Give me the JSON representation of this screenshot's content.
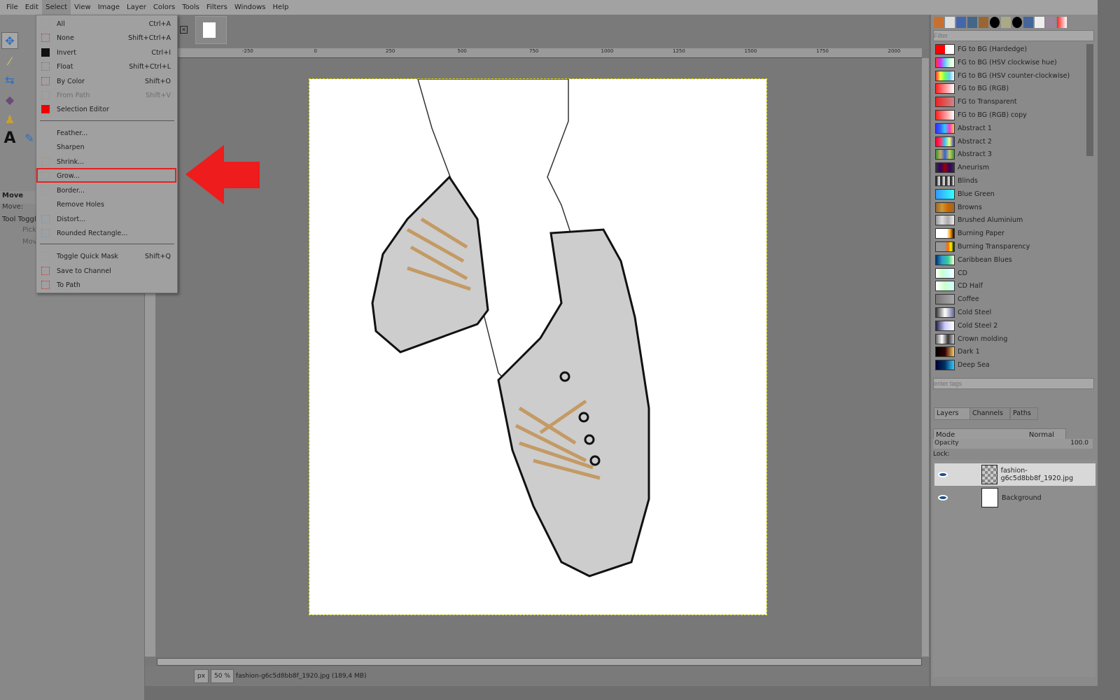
{
  "menubar": {
    "items": [
      "File",
      "Edit",
      "Select",
      "View",
      "Image",
      "Layer",
      "Colors",
      "Tools",
      "Filters",
      "Windows",
      "Help"
    ],
    "active": "Select"
  },
  "select_menu": {
    "items": [
      {
        "label": "All",
        "shortcut": "Ctrl+A",
        "icon": "select-all-icon"
      },
      {
        "label": "None",
        "shortcut": "Shift+Ctrl+A",
        "icon": "select-none-icon"
      },
      {
        "label": "Invert",
        "shortcut": "Ctrl+I",
        "icon": "invert-icon"
      },
      {
        "label": "Float",
        "shortcut": "Shift+Ctrl+L",
        "icon": "float-icon"
      },
      {
        "label": "By Color",
        "shortcut": "Shift+O",
        "icon": "by-color-icon"
      },
      {
        "label": "From Path",
        "shortcut": "Shift+V",
        "icon": "from-path-icon",
        "disabled": true
      },
      {
        "label": "Selection Editor",
        "shortcut": "",
        "icon": "selection-editor-icon"
      },
      {
        "label": "Feather...",
        "shortcut": ""
      },
      {
        "label": "Sharpen",
        "shortcut": ""
      },
      {
        "label": "Shrink...",
        "shortcut": "",
        "icon": "shrink-icon"
      },
      {
        "label": "Grow...",
        "shortcut": "",
        "icon": "grow-icon",
        "highlighted": true
      },
      {
        "label": "Border...",
        "shortcut": "",
        "icon": "border-icon"
      },
      {
        "label": "Remove Holes",
        "shortcut": ""
      },
      {
        "label": "Distort...",
        "shortcut": "",
        "icon": "distort-icon"
      },
      {
        "label": "Rounded Rectangle...",
        "shortcut": "",
        "icon": "rounded-rectangle-icon"
      },
      {
        "label": "Toggle Quick Mask",
        "shortcut": "Shift+Q",
        "icon": "quick-mask-icon"
      },
      {
        "label": "Save to Channel",
        "shortcut": "",
        "icon": "save-channel-icon"
      },
      {
        "label": "To Path",
        "shortcut": "",
        "icon": "to-path-icon"
      }
    ]
  },
  "tool_options": {
    "title": "Move",
    "move_label": "Move:",
    "toggle_label": "Tool Toggle",
    "opt1": "Pick",
    "opt2": "Mov"
  },
  "ruler": {
    "labels": [
      "-250",
      "0",
      "250",
      "500",
      "750",
      "1000",
      "1250",
      "1500",
      "1750",
      "2000"
    ]
  },
  "status": {
    "unit": "px",
    "zoom": "50 %",
    "file": "fashion-g6c5d8bb8f_1920.jpg (189,4 MB)"
  },
  "gradients": {
    "filter_placeholder": "Filter",
    "tags_placeholder": "enter tags",
    "items": [
      {
        "name": "FG to BG (Hardedge)",
        "c": "linear-gradient(90deg,#f00 50%,#fff 50%)"
      },
      {
        "name": "FG to BG (HSV clockwise hue)",
        "c": "linear-gradient(90deg,#f33,#c3f,#6cf,#cfc,#fff)"
      },
      {
        "name": "FG to BG (HSV counter-clockwise)",
        "c": "linear-gradient(90deg,#f33,#ff3,#6f6,#6cf,#fff)"
      },
      {
        "name": "FG to BG (RGB)",
        "c": "linear-gradient(90deg,#f22,#fff)"
      },
      {
        "name": "FG to Transparent",
        "c": "linear-gradient(90deg,#e22,#c88)"
      },
      {
        "name": "FG to BG (RGB) copy",
        "c": "linear-gradient(90deg,#f22,#fff)"
      },
      {
        "name": "Abstract 1",
        "c": "linear-gradient(90deg,#33f,#36f,#3cf,#f3c,#fc3)"
      },
      {
        "name": "Abstract 2",
        "c": "linear-gradient(90deg,#f03,#f36,#3cf,#ff6,#33c)"
      },
      {
        "name": "Abstract 3",
        "c": "linear-gradient(90deg,#393,#ca6,#36c,#cc6,#393)"
      },
      {
        "name": "Aneurism",
        "c": "linear-gradient(90deg,#333,#306,#900,#306,#333)"
      },
      {
        "name": "Blinds",
        "c": "repeating-linear-gradient(90deg,#000,#fff 5px,#000 7px)"
      },
      {
        "name": "Blue Green",
        "c": "linear-gradient(90deg,#39f,#3ff)"
      },
      {
        "name": "Browns",
        "c": "linear-gradient(90deg,#963,#c93,#c60,#963)"
      },
      {
        "name": "Brushed Aluminium",
        "c": "linear-gradient(90deg,#999,#ddd,#aaa,#eee)"
      },
      {
        "name": "Burning Paper",
        "c": "linear-gradient(90deg,#fff 60%,#f90,#000)"
      },
      {
        "name": "Burning Transparency",
        "c": "linear-gradient(90deg,#999 50%,#f60,#ff0,#000)"
      },
      {
        "name": "Caribbean Blues",
        "c": "linear-gradient(90deg,#036,#39c,#3c9,#ffc)"
      },
      {
        "name": "CD",
        "c": "linear-gradient(90deg,#fff,#cfc,#cff,#fff)"
      },
      {
        "name": "CD Half",
        "c": "linear-gradient(90deg,#fff,#cfc,#cff)"
      },
      {
        "name": "Coffee",
        "c": "linear-gradient(90deg,#777,#aaa)"
      },
      {
        "name": "Cold Steel",
        "c": "linear-gradient(90deg,#333,#fff,#669)"
      },
      {
        "name": "Cold Steel 2",
        "c": "linear-gradient(90deg,#224,#ccf,#fff)"
      },
      {
        "name": "Crown molding",
        "c": "linear-gradient(90deg,#666,#fff,#333,#ccc)"
      },
      {
        "name": "Dark 1",
        "c": "linear-gradient(90deg,#000,#300,#fc6)"
      },
      {
        "name": "Deep Sea",
        "c": "linear-gradient(90deg,#003,#036,#3cf)"
      }
    ]
  },
  "layers_panel": {
    "tabs": [
      "Layers",
      "Channels",
      "Paths"
    ],
    "mode_label": "Mode",
    "mode_value": "Normal",
    "opacity_label": "Opacity",
    "opacity_value": "100.0",
    "lock_label": "Lock:",
    "layers": [
      {
        "name": "fashion-g6c5d8bb8f_1920.jpg",
        "selected": true
      },
      {
        "name": "Background",
        "selected": false
      }
    ]
  },
  "colors": {
    "highlight": "#e82020",
    "arrow": "#ee1c1c"
  }
}
